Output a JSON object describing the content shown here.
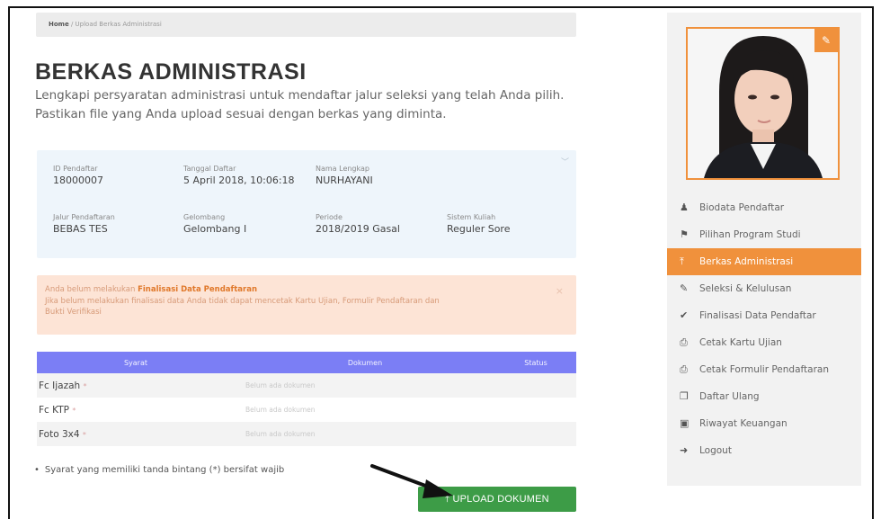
{
  "breadcrumb": {
    "home": "Home",
    "separator": " / ",
    "current": "Upload Berkas Administrasi"
  },
  "page": {
    "title": "BERKAS ADMINISTRASI",
    "description_line1": "Lengkapi persyaratan administrasi untuk mendaftar jalur seleksi yang telah Anda pilih.",
    "description_line2": "Pastikan file yang Anda upload sesuai dengan berkas yang diminta."
  },
  "info": {
    "id_label": "ID Pendaftar",
    "id_value": "18000007",
    "date_label": "Tanggal Daftar",
    "date_value": "5 April 2018, 10:06:18",
    "name_label": "Nama Lengkap",
    "name_value": "NURHAYANI",
    "path_label": "Jalur Pendaftaran",
    "path_value": "BEBAS TES",
    "wave_label": "Gelombang",
    "wave_value": "Gelombang I",
    "period_label": "Periode",
    "period_value": "2018/2019 Gasal",
    "system_label": "Sistem Kuliah",
    "system_value": "Reguler Sore"
  },
  "alert": {
    "prefix": "Anda belum melakukan ",
    "strong": "Finalisasi Data Pendaftaran",
    "line2": "Jika belum melakukan finalisasi data Anda tidak dapat mencetak Kartu Ujian, Formulir Pendaftaran dan",
    "line3": "Bukti Verifikasi",
    "close": "×"
  },
  "table": {
    "headers": [
      "Syarat",
      "Dokumen",
      "Status"
    ],
    "rows": [
      {
        "name": "Fc Ijazah",
        "doc": "Belum ada dokumen",
        "status": ""
      },
      {
        "name": "Fc KTP",
        "doc": "Belum ada dokumen",
        "status": ""
      },
      {
        "name": "Foto 3x4",
        "doc": "Belum ada dokumen",
        "status": ""
      }
    ],
    "required_mark": "*"
  },
  "note": {
    "bullet": "•",
    "text": "Syarat yang memiliki tanda bintang (*) bersifat wajib"
  },
  "upload_button": {
    "label": "UPLOAD DOKUMEN",
    "icon": "upload-icon"
  },
  "sidebar": {
    "menu": [
      {
        "label": "Biodata Pendaftar",
        "icon": "user-icon",
        "glyph": "♟",
        "active": false
      },
      {
        "label": "Pilihan Program Studi",
        "icon": "bookmark-icon",
        "glyph": "⚑",
        "active": false
      },
      {
        "label": "Berkas Administrasi",
        "icon": "upload-icon",
        "glyph": "⤒",
        "active": true
      },
      {
        "label": "Seleksi & Kelulusan",
        "icon": "edit-icon",
        "glyph": "✎",
        "active": false
      },
      {
        "label": "Finalisasi Data Pendaftar",
        "icon": "check-icon",
        "glyph": "✔",
        "active": false
      },
      {
        "label": "Cetak Kartu Ujian",
        "icon": "print-icon",
        "glyph": "⎙",
        "active": false
      },
      {
        "label": "Cetak Formulir Pendaftaran",
        "icon": "print-icon",
        "glyph": "⎙",
        "active": false
      },
      {
        "label": "Daftar Ulang",
        "icon": "copy-icon",
        "glyph": "❐",
        "active": false
      },
      {
        "label": "Riwayat Keuangan",
        "icon": "money-icon",
        "glyph": "▣",
        "active": false
      },
      {
        "label": "Logout",
        "icon": "logout-icon",
        "glyph": "➜",
        "active": false
      }
    ]
  },
  "colors": {
    "accent": "#f0913c",
    "table_header": "#7b7ef5",
    "button": "#3d9c47",
    "info_bg": "#eef5fb",
    "alert_bg": "#fde4d6"
  }
}
